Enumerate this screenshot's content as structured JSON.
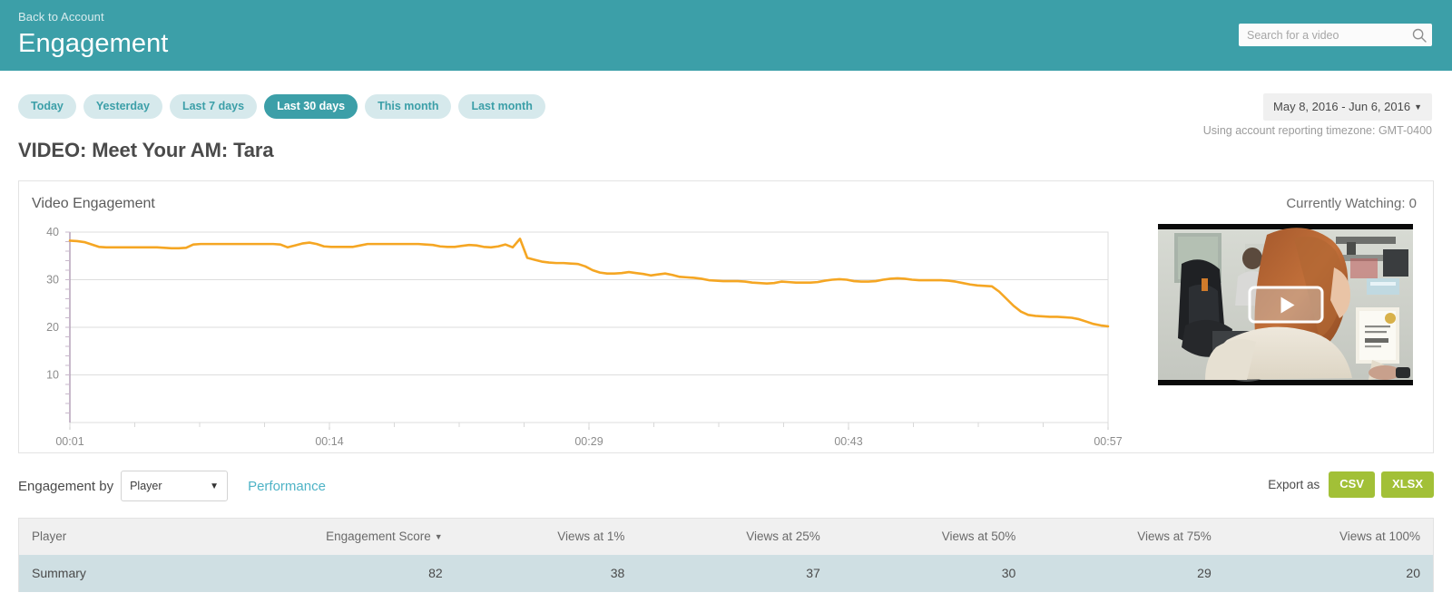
{
  "header": {
    "back_label": "Back to Account",
    "title": "Engagement",
    "search": {
      "placeholder": "Search for a video",
      "value": "",
      "icon": "search-icon"
    },
    "bg_color": "#3c9fa8"
  },
  "filters": {
    "pills": [
      {
        "label": "Today",
        "active": false
      },
      {
        "label": "Yesterday",
        "active": false
      },
      {
        "label": "Last 7 days",
        "active": false
      },
      {
        "label": "Last 30 days",
        "active": true
      },
      {
        "label": "This month",
        "active": false
      },
      {
        "label": "Last month",
        "active": false
      }
    ],
    "date_range": "May 8, 2016 - Jun 6, 2016",
    "date_caret": "▼",
    "timezone_note": "Using account reporting timezone: GMT-0400",
    "active_color": "#3c9fa8",
    "pill_bg": "#d6e9ec"
  },
  "video": {
    "title": "VIDEO: Meet Your AM: Tara"
  },
  "card": {
    "title": "Video Engagement",
    "currently_watching_label": "Currently Watching: 0",
    "play_icon": "play-icon"
  },
  "chart_data": {
    "type": "line",
    "title": "Video Engagement",
    "xlabel": "",
    "ylabel": "",
    "ylim": [
      0,
      40
    ],
    "yticks": [
      40,
      30,
      20,
      10
    ],
    "xticks": [
      "00:01",
      "00:14",
      "00:29",
      "00:43",
      "00:57"
    ],
    "grid": true,
    "legend": "none",
    "line_color": "#f5a623",
    "series": [
      {
        "name": "Engagement",
        "values": [
          38.2,
          38.1,
          37.9,
          37.4,
          36.9,
          36.8,
          36.8,
          36.8,
          36.8,
          36.8,
          36.8,
          36.8,
          36.8,
          36.7,
          36.6,
          36.6,
          36.7,
          37.4,
          37.5,
          37.5,
          37.5,
          37.5,
          37.5,
          37.5,
          37.5,
          37.5,
          37.5,
          37.5,
          37.5,
          37.4,
          36.8,
          37.2,
          37.6,
          37.8,
          37.5,
          37.0,
          36.9,
          36.9,
          36.9,
          36.9,
          37.2,
          37.5,
          37.5,
          37.5,
          37.5,
          37.5,
          37.5,
          37.5,
          37.5,
          37.4,
          37.3,
          37.0,
          36.9,
          36.9,
          37.1,
          37.3,
          37.2,
          36.9,
          36.8,
          37.0,
          37.4,
          36.8,
          38.6,
          34.6,
          34.2,
          33.8,
          33.6,
          33.5,
          33.5,
          33.4,
          33.3,
          32.8,
          32.0,
          31.5,
          31.3,
          31.3,
          31.4,
          31.6,
          31.4,
          31.2,
          30.9,
          31.1,
          31.3,
          31.0,
          30.6,
          30.5,
          30.4,
          30.2,
          29.9,
          29.8,
          29.7,
          29.7,
          29.7,
          29.6,
          29.4,
          29.3,
          29.2,
          29.3,
          29.6,
          29.5,
          29.4,
          29.4,
          29.4,
          29.5,
          29.8,
          30.0,
          30.1,
          30.0,
          29.7,
          29.6,
          29.6,
          29.7,
          30.0,
          30.2,
          30.3,
          30.2,
          30.0,
          29.9,
          29.9,
          29.9,
          29.9,
          29.8,
          29.6,
          29.3,
          29.0,
          28.8,
          28.7,
          28.6,
          27.5,
          26.0,
          24.5,
          23.3,
          22.6,
          22.4,
          22.3,
          22.2,
          22.2,
          22.1,
          22.0,
          21.7,
          21.2,
          20.7,
          20.4,
          20.2
        ]
      }
    ]
  },
  "controls": {
    "engagement_by_label": "Engagement by",
    "select_value": "Player",
    "select_caret": "▼",
    "performance_link": "Performance",
    "export_label": "Export as",
    "export_buttons": [
      {
        "label": "CSV"
      },
      {
        "label": "XLSX"
      }
    ],
    "export_color": "#a2c037"
  },
  "table": {
    "columns": [
      "Player",
      "Engagement Score",
      "Views at 1%",
      "Views at 25%",
      "Views at 50%",
      "Views at 75%",
      "Views at 100%"
    ],
    "sorted_column": "Engagement Score",
    "sort_caret": "▼",
    "rows": [
      {
        "label": "Summary",
        "engagement_score": "82",
        "views_1": "38",
        "views_25": "37",
        "views_50": "30",
        "views_75": "29",
        "views_100": "20"
      }
    ]
  }
}
